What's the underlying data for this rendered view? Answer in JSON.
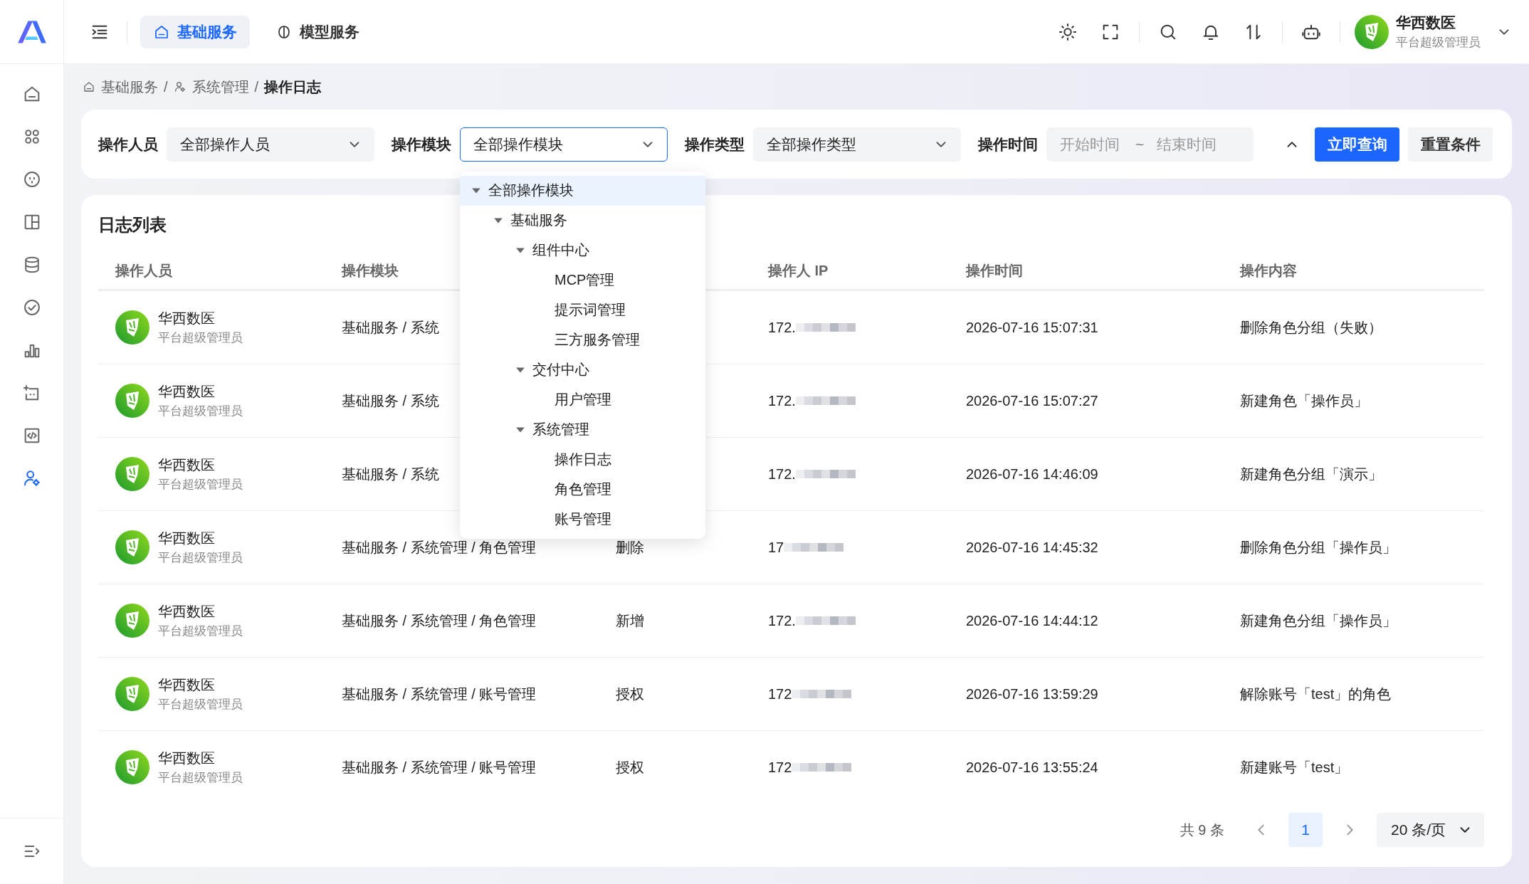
{
  "top_tabs": [
    {
      "label": "基础服务",
      "selected": true
    },
    {
      "label": "模型服务",
      "selected": false
    }
  ],
  "user": {
    "name": "华西数医",
    "role": "平台超级管理员"
  },
  "sidebar": {
    "items": [
      {
        "selected": false
      },
      {
        "selected": false
      },
      {
        "selected": false
      },
      {
        "selected": false
      },
      {
        "selected": false
      },
      {
        "selected": false
      },
      {
        "selected": false
      },
      {
        "selected": false
      },
      {
        "selected": false
      },
      {
        "selected": true
      }
    ]
  },
  "breadcrumb": {
    "separator": "/",
    "items": [
      {
        "label": "基础服务",
        "current": false
      },
      {
        "label": "系统管理",
        "current": false
      },
      {
        "label": "操作日志",
        "current": true
      }
    ]
  },
  "filters": [
    {
      "kind": "select",
      "label": "操作人员",
      "value": "全部操作人员",
      "focused": false
    },
    {
      "kind": "select",
      "label": "操作模块",
      "value": "全部操作模块",
      "focused": true
    },
    {
      "kind": "select",
      "label": "操作类型",
      "value": "全部操作类型",
      "focused": false
    },
    {
      "kind": "daterange",
      "label": "操作时间",
      "start_placeholder": "开始时间",
      "separator": "~",
      "end_placeholder": "结束时间"
    }
  ],
  "collapse_toggle": {
    "expanded": true
  },
  "filter_actions": [
    {
      "label": "立即查询",
      "kind": "primary"
    },
    {
      "label": "重置条件",
      "kind": "default"
    }
  ],
  "module_dropdown": {
    "items": [
      {
        "label": "全部操作模块",
        "selected": true,
        "expanded": true,
        "children": [
          {
            "label": "基础服务",
            "selected": false,
            "expanded": true,
            "children": [
              {
                "label": "组件中心",
                "selected": false,
                "expanded": true,
                "children": [
                  {
                    "label": "MCP管理",
                    "selected": false
                  },
                  {
                    "label": "提示词管理",
                    "selected": false
                  },
                  {
                    "label": "三方服务管理",
                    "selected": false
                  }
                ]
              },
              {
                "label": "交付中心",
                "selected": false,
                "expanded": true,
                "children": [
                  {
                    "label": "用户管理",
                    "selected": false
                  }
                ]
              },
              {
                "label": "系统管理",
                "selected": false,
                "expanded": true,
                "children": [
                  {
                    "label": "操作日志",
                    "selected": false
                  },
                  {
                    "label": "角色管理",
                    "selected": false
                  },
                  {
                    "label": "账号管理",
                    "selected": false
                  }
                ]
              }
            ]
          }
        ]
      }
    ]
  },
  "log_list": {
    "title": "日志列表",
    "columns": [
      "操作人员",
      "操作模块",
      "操作人 IP",
      "操作时间",
      "操作内容"
    ],
    "rows": [
      {
        "operator": "华西数医",
        "role": "平台超级管理员",
        "module": "基础服务 / 系统",
        "ip": "172.",
        "time": "2026-07-16 15:07:31",
        "content": "删除角色分组（失败）"
      },
      {
        "operator": "华西数医",
        "role": "平台超级管理员",
        "module": "基础服务 / 系统",
        "ip": "172.",
        "time": "2026-07-16 15:07:27",
        "content": "新建角色「操作员」"
      },
      {
        "operator": "华西数医",
        "role": "平台超级管理员",
        "module": "基础服务 / 系统",
        "ip": "172.",
        "time": "2026-07-16 14:46:09",
        "content": "新建角色分组「演示」"
      },
      {
        "operator": "华西数医",
        "role": "平台超级管理员",
        "module": "基础服务 / 系统管理 / 角色管理",
        "type": "删除",
        "ip": "17",
        "time": "2026-07-16 14:45:32",
        "content": "删除角色分组「操作员」"
      },
      {
        "operator": "华西数医",
        "role": "平台超级管理员",
        "module": "基础服务 / 系统管理 / 角色管理",
        "type": "新增",
        "ip": "172.",
        "time": "2026-07-16 14:44:12",
        "content": "新建角色分组「操作员」"
      },
      {
        "operator": "华西数医",
        "role": "平台超级管理员",
        "module": "基础服务 / 系统管理 / 账号管理",
        "type": "授权",
        "ip": "172",
        "time": "2026-07-16 13:59:29",
        "content": "解除账号「test」的角色"
      },
      {
        "operator": "华西数医",
        "role": "平台超级管理员",
        "module": "基础服务 / 系统管理 / 账号管理",
        "type": "授权",
        "ip": "172",
        "time": "2026-07-16 13:55:24",
        "content": "新建账号「test」"
      }
    ]
  },
  "pagination": {
    "total": "共 9 条",
    "pages": [
      {
        "label": "1",
        "selected": true
      }
    ],
    "page_size": "20 条/页"
  }
}
